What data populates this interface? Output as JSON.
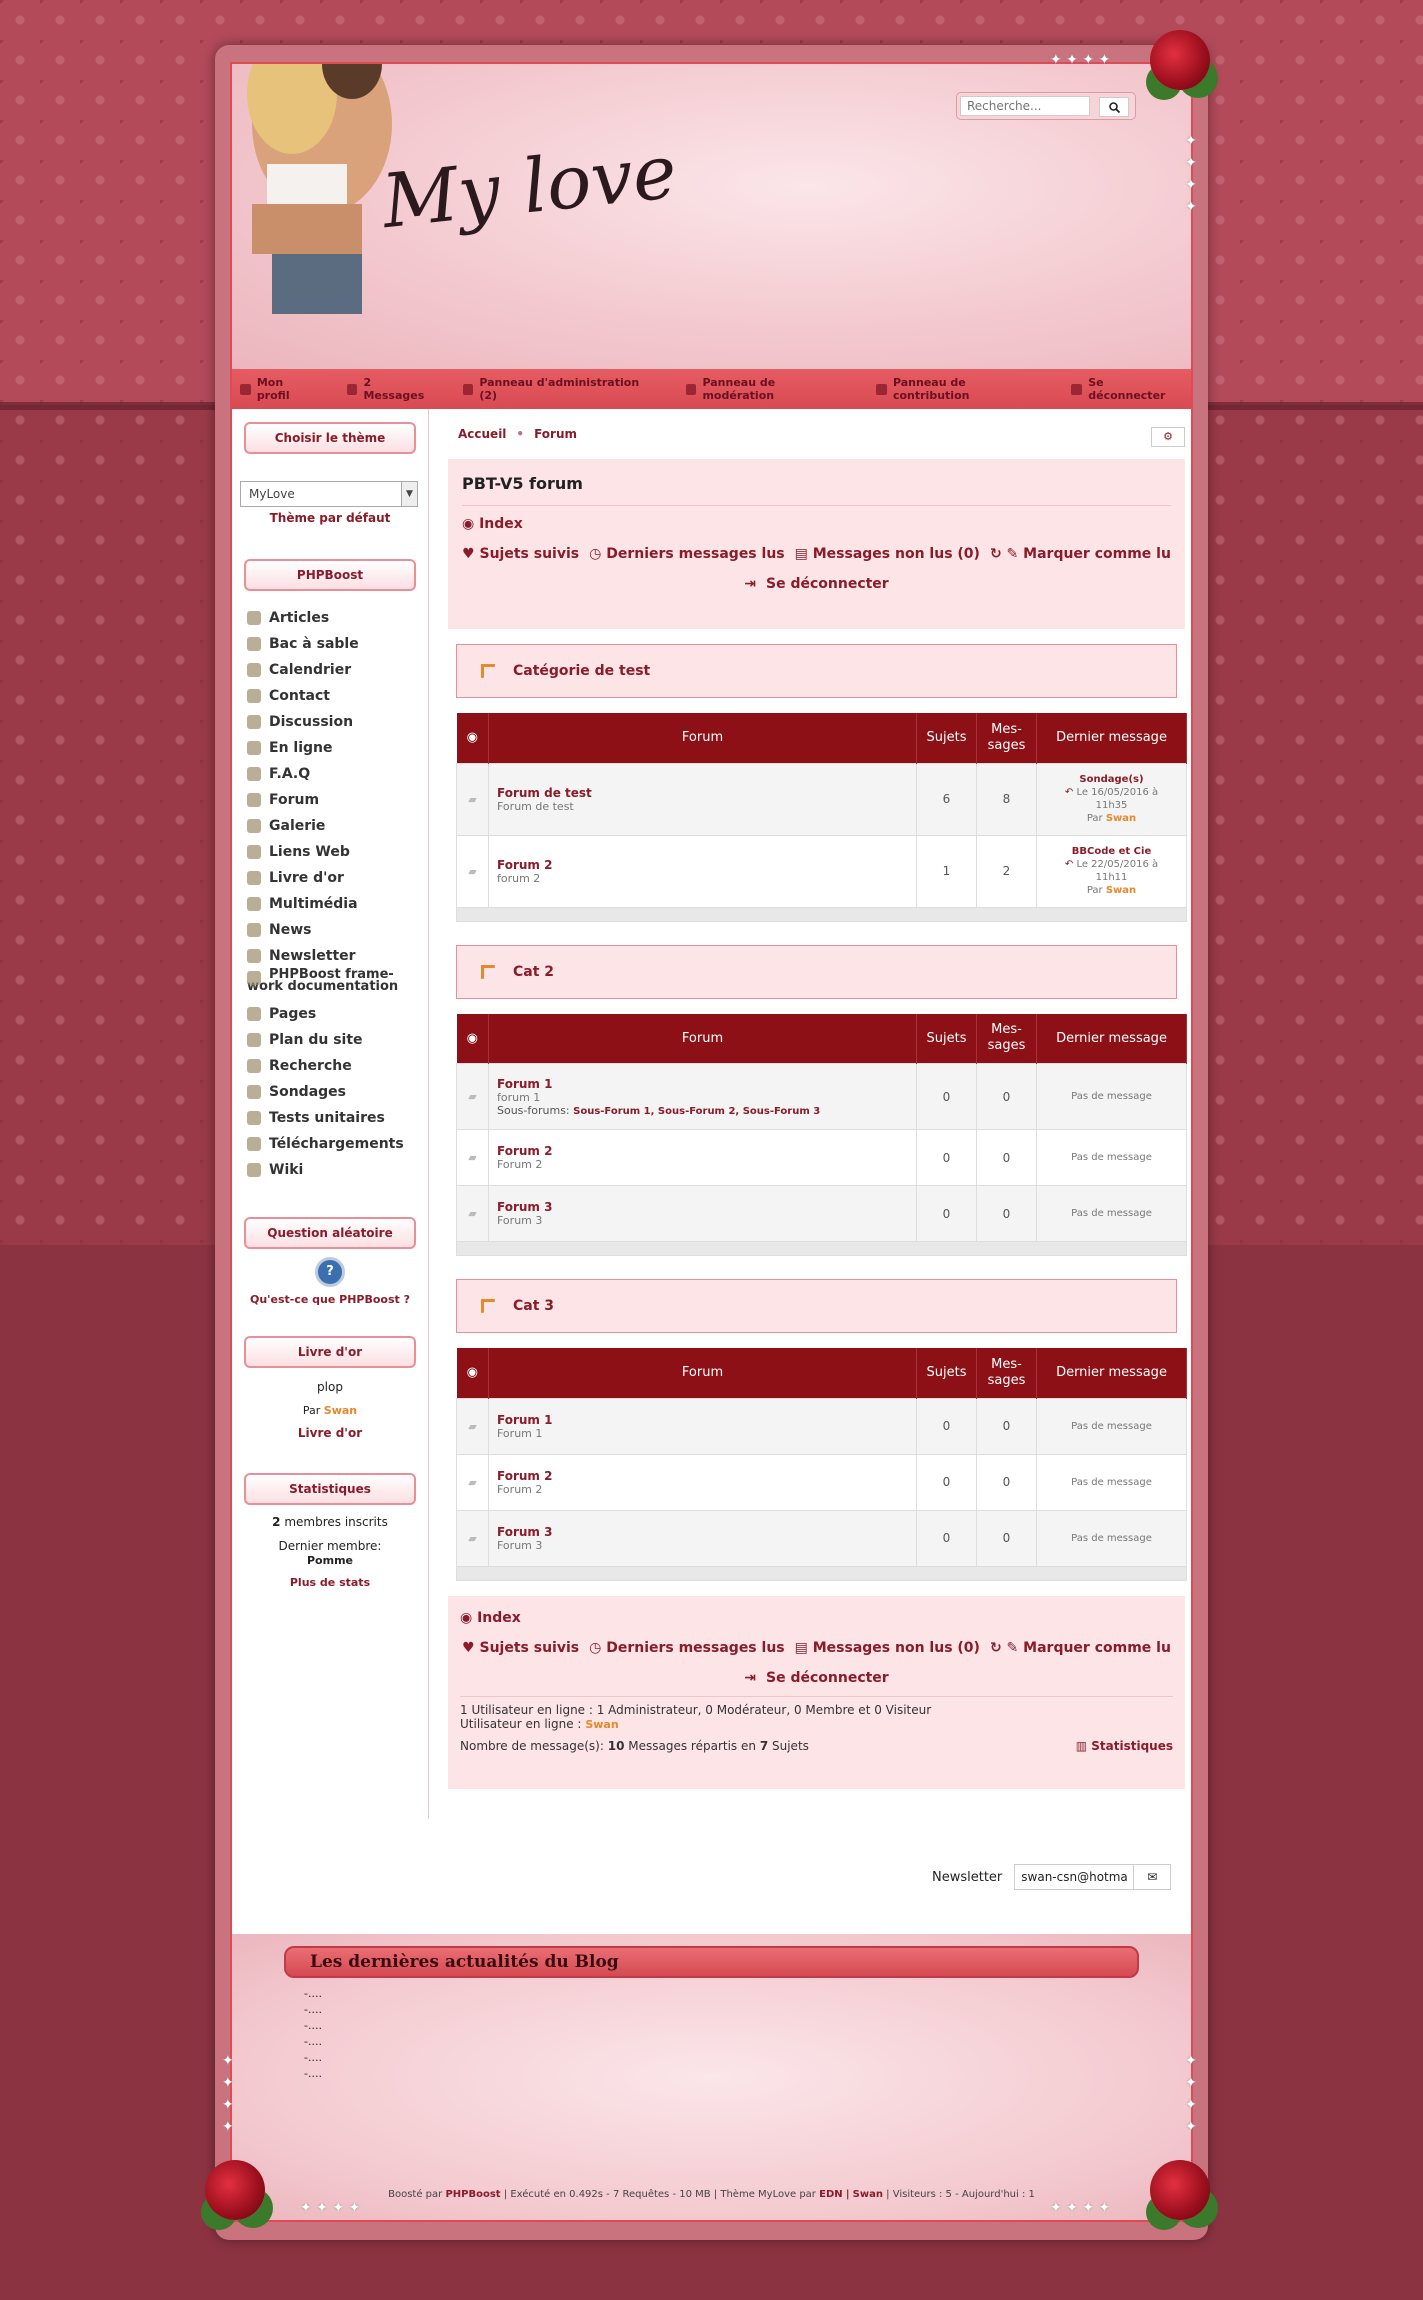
{
  "header": {
    "logo": "My love",
    "search_placeholder": "Recherche..."
  },
  "topnav": [
    "Mon profil",
    "2 Messages",
    "Panneau d'administration (2)",
    "Panneau de modération",
    "Panneau de contribution",
    "Se déconnecter"
  ],
  "left": {
    "theme_btn": "Choisir le thème",
    "theme_value": "MyLove",
    "theme_default": "Thème par défaut",
    "phpboost_btn": "PHPBoost",
    "menu": [
      "Articles",
      "Bac à sable",
      "Calendrier",
      "Contact",
      "Discussion",
      "En ligne",
      "F.A.Q",
      "Forum",
      "Galerie",
      "Liens Web",
      "Livre d'or",
      "Multimédia",
      "News",
      "Newsletter",
      "PHPBoost frame-",
      "work documentation",
      "Pages",
      "Plan du site",
      "Recherche",
      "Sondages",
      "Tests unitaires",
      "Téléchargements",
      "Wiki"
    ],
    "question_btn": "Question aléatoire",
    "question_text": "Qu'est-ce que PHPBoost ?",
    "guestbook_btn": "Livre d'or",
    "guestbook_msg": "plop",
    "guestbook_by": "Par",
    "guestbook_user": "Swan",
    "guestbook_link": "Livre d'or",
    "stats_btn": "Statistiques",
    "stats_members_count": "2",
    "stats_members": "membres inscrits",
    "stats_last": "Dernier membre:",
    "stats_last_name": "Pomme",
    "stats_more": "Plus de stats"
  },
  "main": {
    "breadcrumb": [
      "Accueil",
      "Forum"
    ],
    "title": "PBT-V5 forum",
    "index": "Index",
    "tools": {
      "followed": "Sujets suivis",
      "last": "Derniers messages lus",
      "unread": "Messages non lus (0)",
      "mark": "Marquer comme lu",
      "logout": "Se déconnecter"
    },
    "cols": {
      "forum": "Forum",
      "subjects": "Sujets",
      "messages": "Mes-",
      "messages2": "sages",
      "last": "Dernier message"
    },
    "categories": [
      {
        "name": "Catégorie de test",
        "rows": [
          {
            "name": "Forum de test",
            "desc": "Forum de test",
            "s": "6",
            "m": "8",
            "lt": "Sondage(s)",
            "ld": "Le 16/05/2016 à",
            "lh": "11h35",
            "lby": "Par",
            "lu": "Swan"
          },
          {
            "name": "Forum 2",
            "desc": "forum 2",
            "s": "1",
            "m": "2",
            "lt": "BBCode et Cie",
            "ld": "Le 22/05/2016 à",
            "lh": "11h11",
            "lby": "Par",
            "lu": "Swan"
          }
        ]
      },
      {
        "name": "Cat 2",
        "rows": [
          {
            "name": "Forum 1",
            "desc": "forum 1",
            "sub_label": "Sous-forums:",
            "sub": "Sous-Forum 1, Sous-Forum 2, Sous-Forum 3",
            "s": "0",
            "m": "0",
            "none": "Pas de message"
          },
          {
            "name": "Forum 2",
            "desc": "Forum 2",
            "s": "0",
            "m": "0",
            "none": "Pas de message"
          },
          {
            "name": "Forum 3",
            "desc": "Forum 3",
            "s": "0",
            "m": "0",
            "none": "Pas de message"
          }
        ]
      },
      {
        "name": "Cat 3",
        "rows": [
          {
            "name": "Forum 1",
            "desc": "Forum 1",
            "s": "0",
            "m": "0",
            "none": "Pas de message"
          },
          {
            "name": "Forum 2",
            "desc": "Forum 2",
            "s": "0",
            "m": "0",
            "none": "Pas de message"
          },
          {
            "name": "Forum 3",
            "desc": "Forum 3",
            "s": "0",
            "m": "0",
            "none": "Pas de message"
          }
        ]
      }
    ],
    "online1": "1 Utilisateur en ligne : 1 Administrateur, 0 Modérateur, 0 Membre et 0 Visiteur",
    "online2": "Utilisateur en ligne :",
    "online_user": "Swan",
    "count_pre": "Nombre de message(s):",
    "count_msgs": "10",
    "count_mid": "Messages répartis en",
    "count_subj": "7",
    "count_post": "Sujets",
    "stats": "Statistiques"
  },
  "newsletter": {
    "label": "Newsletter",
    "value": "swan-csn@hotma"
  },
  "blog": {
    "title": "Les dernières actualités du Blog",
    "items": [
      "-....",
      "-....",
      "-....",
      "-....",
      "-....",
      "-...."
    ]
  },
  "footer": {
    "pre": "Boosté par",
    "phpboost": "PHPBoost",
    "mid": "| Exécuté en 0.492s - 7 Requêtes - 10 MB | Thème MyLove par",
    "edn": "EDN",
    "sep": "|",
    "swan": "Swan",
    "post": "| Visiteurs : 5 - Aujourd'hui : 1"
  },
  "colors": {
    "accent": "#8a1c2a",
    "bar": "#8c1016",
    "highlight": "#e8872a"
  }
}
